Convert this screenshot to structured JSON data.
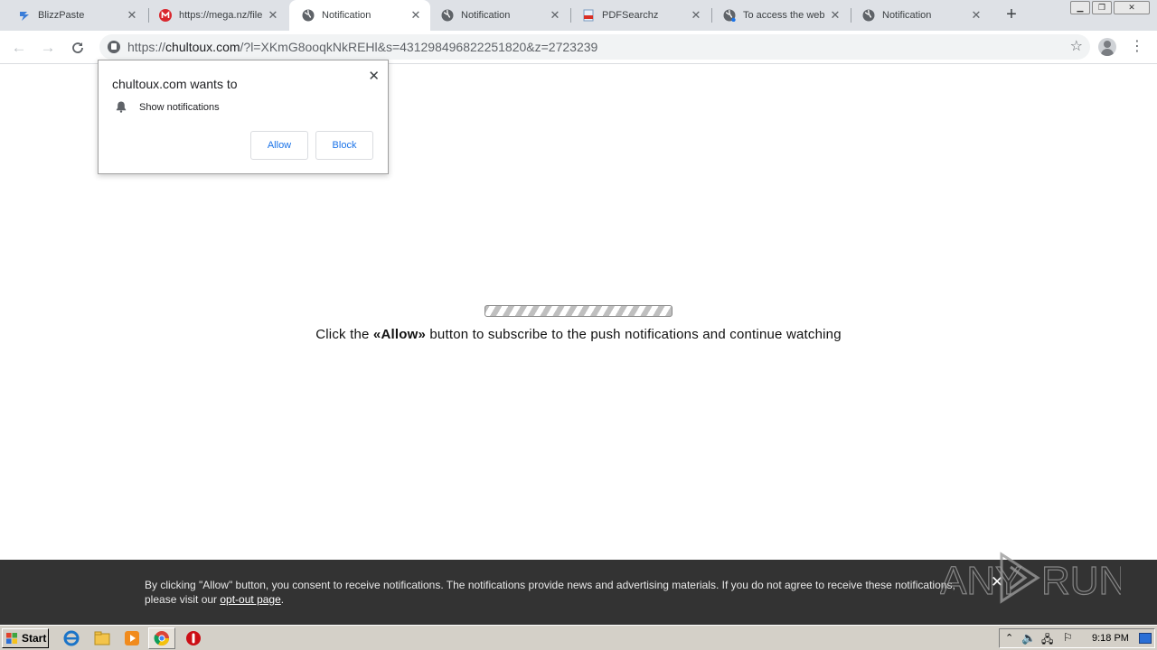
{
  "tabs": [
    {
      "title": "BlizzPaste",
      "icon": "blizzpaste-icon",
      "active": false
    },
    {
      "title": "https://mega.nz/file",
      "icon": "mega-icon",
      "active": false
    },
    {
      "title": "Notification",
      "icon": "globe-icon",
      "active": true
    },
    {
      "title": "Notification",
      "icon": "globe-icon",
      "active": false
    },
    {
      "title": "PDFSearchz",
      "icon": "pdfsearchz-icon",
      "active": false
    },
    {
      "title": "To access the web",
      "icon": "globe-icon",
      "active": false
    },
    {
      "title": "Notification",
      "icon": "globe-icon",
      "active": false
    }
  ],
  "toolbar": {
    "url_scheme": "https://",
    "url_domain": "chultoux.com",
    "url_rest": "/?l=XKmG8ooqkNkREHl&s=431298496822251820&z=2723239"
  },
  "popup": {
    "title": "chultoux.com wants to",
    "permission": "Show notifications",
    "allow_label": "Allow",
    "block_label": "Block"
  },
  "content": {
    "msg_before": "Click the ",
    "msg_bold": "«Allow»",
    "msg_after": " button to subscribe to the push notifications and continue watching"
  },
  "consent": {
    "text": "By clicking \"Allow\" button, you consent to receive notifications. The notifications provide news and advertising materials. If you do not agree to receive these notifications, please visit our ",
    "link": "opt-out page",
    "end": "."
  },
  "watermark": {
    "text": "ANY RUN"
  },
  "taskbar": {
    "start_label": "Start",
    "clock": "9:18 PM"
  },
  "colors": {
    "consent_bg": "#333333",
    "link_blue": "#1a73e8",
    "tab_strip": "#dee1e6"
  }
}
